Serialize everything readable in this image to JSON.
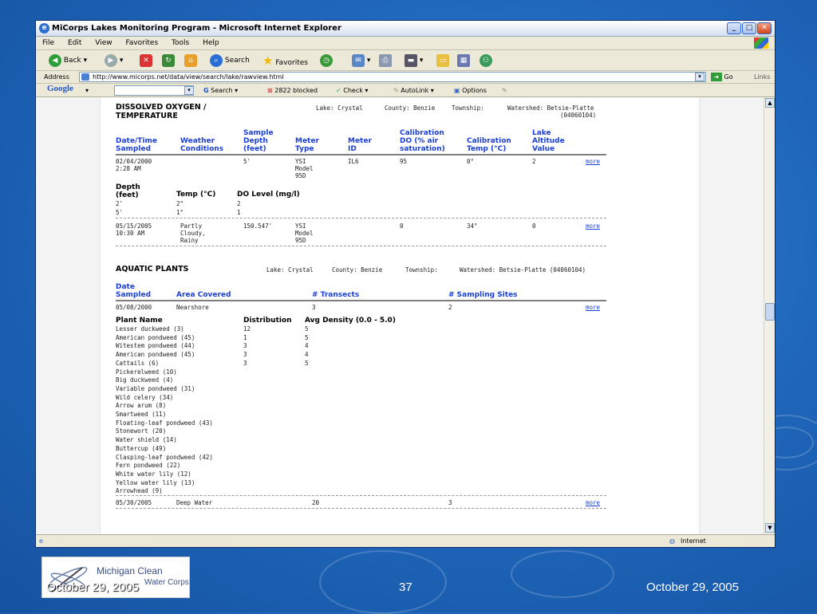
{
  "window": {
    "title": "MiCorps Lakes Monitoring Program - Microsoft Internet Explorer"
  },
  "menu": [
    "File",
    "Edit",
    "View",
    "Favorites",
    "Tools",
    "Help"
  ],
  "toolbar": {
    "back": "Back",
    "search": "Search",
    "favorites": "Favorites"
  },
  "address": {
    "label": "Address",
    "url": "http://www.micorps.net/data/view/search/lake/rawview.html",
    "go": "Go",
    "links": "Links"
  },
  "googlebar": {
    "brand": "Google",
    "search": "Search",
    "blocked": "2822 blocked",
    "check": "Check",
    "autolink": "AutoLink",
    "options": "Options"
  },
  "statusbar": {
    "zone": "Internet"
  },
  "do_section": {
    "title_line1": "DISSOLVED OXYGEN /",
    "title_line2": "TEMPERATURE",
    "lake": "Lake: Crystal",
    "county": "County: Benzie",
    "township": "Township:",
    "watershed": "Watershed: Betsie-Platte",
    "watershed_code": "(04060104)",
    "headers": {
      "date": [
        "Date/Time",
        "Sampled"
      ],
      "weather": [
        "Weather",
        "Conditions"
      ],
      "depth": [
        "Sample",
        "Depth",
        "(feet)"
      ],
      "meter_type": [
        "Meter",
        "Type"
      ],
      "meter_id": [
        "Meter",
        "ID"
      ],
      "calib_do": [
        "Calibration",
        "DO (% air",
        "saturation)"
      ],
      "calib_temp": [
        "Calibration",
        "Temp (°C)"
      ],
      "altitude": [
        "Lake",
        "Altitude",
        "Value"
      ]
    },
    "rows": [
      {
        "date": [
          "02/04/2000",
          "2:28 AM"
        ],
        "weather": [],
        "depth": "5'",
        "meter_type": [
          "YSI",
          "Model",
          "95D"
        ],
        "meter_id": "IL6",
        "calib_do": "95",
        "calib_temp": "0°",
        "altitude": "2",
        "more": "more"
      },
      {
        "date": [
          "05/15/2005",
          "10:30 AM"
        ],
        "weather": [
          "Partly",
          "Cloudy,",
          "Rainy"
        ],
        "depth": "150.547'",
        "meter_type": [
          "YSI",
          "Model",
          "95D"
        ],
        "meter_id": "",
        "calib_do": "0",
        "calib_temp": "34°",
        "altitude": "0",
        "more": "more"
      }
    ],
    "sub_headers": {
      "depth": [
        "Depth",
        "(feet)"
      ],
      "temp": "Temp (°C)",
      "do": "DO Level (mg/l)"
    },
    "sub_rows": [
      {
        "depth": "2'",
        "temp": "2°",
        "do": "2"
      },
      {
        "depth": "5'",
        "temp": "1°",
        "do": "1"
      }
    ]
  },
  "ap_section": {
    "title": "AQUATIC PLANTS",
    "lake": "Lake: Crystal",
    "county": "County: Benzie",
    "township": "Township:",
    "watershed": "Watershed: Betsie-Platte (04060104)",
    "headers": {
      "date": [
        "Date",
        "Sampled"
      ],
      "area": "Area Covered",
      "transects": "# Transects",
      "sites": "# Sampling Sites"
    },
    "rows": [
      {
        "date": "05/08/2000",
        "area": "Nearshore",
        "transects": "3",
        "sites": "2",
        "more": "more"
      },
      {
        "date": "05/30/2005",
        "area": "Deep Water",
        "transects": "20",
        "sites": "3",
        "more": "more"
      }
    ],
    "plant_headers": {
      "name": "Plant Name",
      "dist": "Distribution",
      "density": "Avg Density (0.0 - 5.0)"
    },
    "plants": [
      {
        "name": "Lesser duckweed (3)",
        "dist": "12",
        "density": "5"
      },
      {
        "name": "American pondweed (45)",
        "dist": "1",
        "density": "5"
      },
      {
        "name": "Witestem pondweed (44)",
        "dist": "3",
        "density": "4"
      },
      {
        "name": "American pondweed (45)",
        "dist": "3",
        "density": "4"
      },
      {
        "name": "Cattails (6)",
        "dist": "3",
        "density": "5"
      },
      {
        "name": "Pickerelweed (10)",
        "dist": "",
        "density": ""
      },
      {
        "name": "Big duckweed (4)",
        "dist": "",
        "density": ""
      },
      {
        "name": "Variable pondweed (31)",
        "dist": "",
        "density": ""
      },
      {
        "name": "Wild celery (34)",
        "dist": "",
        "density": ""
      },
      {
        "name": "Arrow arum (8)",
        "dist": "",
        "density": ""
      },
      {
        "name": "Smartweed (11)",
        "dist": "",
        "density": ""
      },
      {
        "name": "Floating-leaf pondweed (43)",
        "dist": "",
        "density": ""
      },
      {
        "name": "Stonewort (20)",
        "dist": "",
        "density": ""
      },
      {
        "name": "Water shield (14)",
        "dist": "",
        "density": ""
      },
      {
        "name": "Buttercup (49)",
        "dist": "",
        "density": ""
      },
      {
        "name": "Clasping-leaf pondweed (42)",
        "dist": "",
        "density": ""
      },
      {
        "name": "Fern pondweed (22)",
        "dist": "",
        "density": ""
      },
      {
        "name": "White water lily (12)",
        "dist": "",
        "density": ""
      },
      {
        "name": "Yellow water lily (13)",
        "dist": "",
        "density": ""
      },
      {
        "name": "Arrowhead (9)",
        "dist": "",
        "density": ""
      }
    ]
  },
  "footer": {
    "logo_line1": "Michigan Clean",
    "logo_line2": "Water Corps",
    "date_left": "October 29, 2005",
    "page": "37",
    "date_right": "October 29, 2005"
  }
}
